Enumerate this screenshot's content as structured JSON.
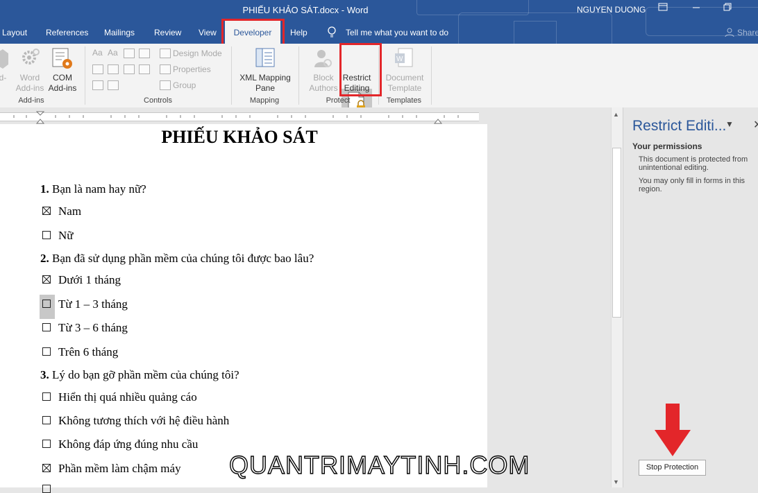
{
  "titlebar": {
    "title": "PHIẾU KHẢO SÁT.docx  -  Word",
    "user": "NGUYEN DUONG",
    "tabs": [
      "Layout",
      "References",
      "Mailings",
      "Review",
      "View",
      "Developer",
      "Help"
    ],
    "tell_me": "Tell me what you want to do",
    "share": "Share"
  },
  "ribbon": {
    "addins": {
      "word_addins": "Word Add-ins",
      "com_addins": "COM Add-ins",
      "group": "Add-ins",
      "partial_left": "d-"
    },
    "controls": {
      "design_mode": "Design Mode",
      "properties": "Properties",
      "group_btn": "Group",
      "group": "Controls"
    },
    "mapping": {
      "xml_pane": "XML Mapping Pane",
      "group": "Mapping"
    },
    "protect": {
      "block_authors": "Block Authors",
      "restrict_editing": "Restrict Editing",
      "group": "Protect"
    },
    "templates": {
      "document_template": "Document Template",
      "group": "Templates"
    }
  },
  "document": {
    "title": "PHIẾU KHẢO SÁT",
    "questions": [
      {
        "num": "1.",
        "text": "Bạn là nam hay nữ?"
      },
      {
        "num": "2.",
        "text": "Bạn đã sử dụng phần mềm của chúng tôi được bao lâu?"
      },
      {
        "num": "3.",
        "text": "Lý do bạn gỡ phần mềm của chúng tôi?"
      }
    ],
    "options": [
      {
        "label": "Nam",
        "checked": true
      },
      {
        "label": "Nữ",
        "checked": false
      },
      {
        "label": "Dưới 1 tháng",
        "checked": true
      },
      {
        "label": "Từ 1 – 3 tháng",
        "checked": false
      },
      {
        "label": "Từ 3 – 6 tháng",
        "checked": false
      },
      {
        "label": "Trên 6 tháng",
        "checked": false
      },
      {
        "label": "Hiển thị quá nhiều quảng cáo",
        "checked": false
      },
      {
        "label": "Không tương thích với hệ điều hành",
        "checked": false
      },
      {
        "label": "Không đáp ứng đúng nhu cầu",
        "checked": false
      },
      {
        "label": "Phần mềm làm chậm máy",
        "checked": true
      }
    ]
  },
  "pane": {
    "title": "Restrict Editi...",
    "permissions_heading": "Your permissions",
    "permission_1": "This document is protected from unintentional editing.",
    "permission_2": "You may only fill in forms in this region.",
    "stop_button": "Stop Protection"
  },
  "watermark": "QUANTRIMAYTINH.COM",
  "colors": {
    "accent": "#2b579a",
    "highlight_red": "#e3262a"
  }
}
